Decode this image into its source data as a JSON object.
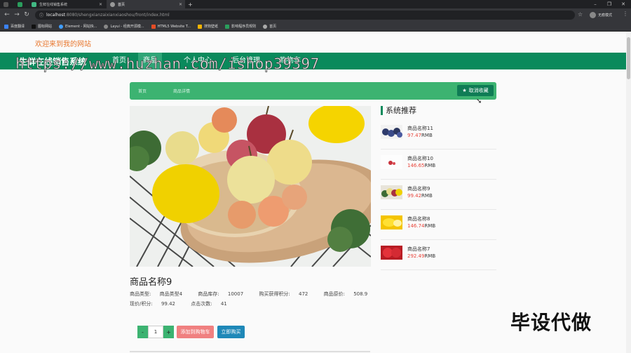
{
  "browser": {
    "tabs": [
      {
        "label": "",
        "active": false
      },
      {
        "label": "",
        "active": false
      },
      {
        "label": "生鲜在线销售系统",
        "active": false
      },
      {
        "label": "首页",
        "active": true
      }
    ],
    "url_host": "localhost",
    "url_path": ":8080/shengxianzaixianxiaoshou/front/index.html",
    "profile_label": "无痕模式",
    "bookmarks": [
      "百度翻译",
      "图标网站",
      "Element - 网站快...",
      "Layui - 经典开源模...",
      "HTML5 Website T...",
      "搜狗壁纸",
      "影响程序员规则",
      "首页"
    ]
  },
  "header": {
    "welcome": "欢迎来到我的网站",
    "brand": "生鲜在线销售系统",
    "nav": [
      "首页",
      "商品",
      "个人中心",
      "后台管理",
      "购物车"
    ],
    "watermark": "https://www.huzhan.com/ishop39397"
  },
  "breadcrumb": {
    "home": "首页",
    "current": "商品详情",
    "fav_label": "取消收藏"
  },
  "recommend": {
    "title": "系统推荐",
    "items": [
      {
        "name": "商品名称11",
        "price": "97.47",
        "unit": "RMB"
      },
      {
        "name": "商品名称10",
        "price": "146.65",
        "unit": "RMB"
      },
      {
        "name": "商品名称9",
        "price": "99.42",
        "unit": "RMB"
      },
      {
        "name": "商品名称8",
        "price": "146.74",
        "unit": "RMB"
      },
      {
        "name": "商品名称7",
        "price": "292.49",
        "unit": "RMB"
      }
    ]
  },
  "product": {
    "name": "商品名称9",
    "type_label": "商品类型:",
    "type_value": "商品类型4",
    "stock_label": "商品库存:",
    "stock_value": "10007",
    "points_label": "购买获得积分:",
    "points_value": "472",
    "orig_label": "商品原价:",
    "orig_value": "508.9",
    "price_label": "现价/积分:",
    "price_value": "99.42",
    "clicks_label": "点击次数:",
    "clicks_value": "41"
  },
  "actions": {
    "minus": "-",
    "qty": "1",
    "plus": "+",
    "cart": "添加到购物车",
    "buy": "立即购买"
  },
  "overlay": "毕设代做"
}
